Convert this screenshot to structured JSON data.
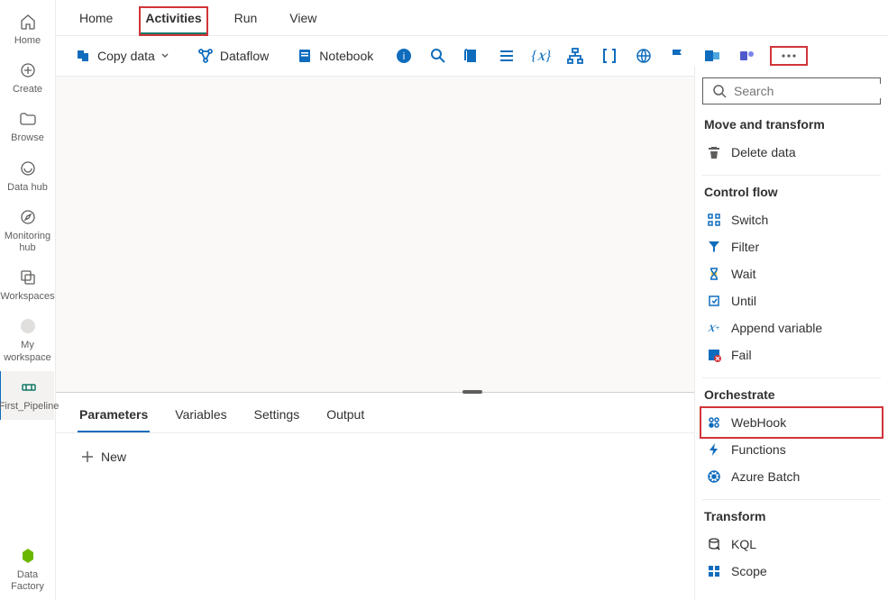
{
  "rail": {
    "items": [
      {
        "label": "Home",
        "icon": "home-icon"
      },
      {
        "label": "Create",
        "icon": "plus-circle-icon"
      },
      {
        "label": "Browse",
        "icon": "folder-icon"
      },
      {
        "label": "Data hub",
        "icon": "onelake-icon"
      },
      {
        "label": "Monitoring hub",
        "icon": "compass-icon"
      },
      {
        "label": "Workspaces",
        "icon": "workspaces-icon"
      },
      {
        "label": "My workspace",
        "icon": "avatar-icon"
      },
      {
        "label": "First_Pipeline",
        "icon": "pipeline-icon"
      }
    ],
    "footer": {
      "label": "Data Factory",
      "icon": "data-factory-icon"
    }
  },
  "tabs": {
    "items": [
      {
        "label": "Home"
      },
      {
        "label": "Activities",
        "active": true,
        "highlight": true
      },
      {
        "label": "Run"
      },
      {
        "label": "View"
      }
    ]
  },
  "toolbar": {
    "copy_data_label": "Copy data",
    "dataflow_label": "Dataflow",
    "notebook_label": "Notebook"
  },
  "bottom_tabs": {
    "items": [
      {
        "label": "Parameters",
        "active": true
      },
      {
        "label": "Variables"
      },
      {
        "label": "Settings"
      },
      {
        "label": "Output"
      }
    ],
    "new_label": "New"
  },
  "flyout": {
    "search_placeholder": "Search",
    "sections": [
      {
        "title": "Move and transform",
        "items": [
          {
            "label": "Delete data",
            "icon": "trash-icon"
          }
        ]
      },
      {
        "title": "Control flow",
        "items": [
          {
            "label": "Switch",
            "icon": "switch-icon"
          },
          {
            "label": "Filter",
            "icon": "filter-icon"
          },
          {
            "label": "Wait",
            "icon": "hourglass-icon"
          },
          {
            "label": "Until",
            "icon": "until-icon"
          },
          {
            "label": "Append variable",
            "icon": "variable-add-icon"
          },
          {
            "label": "Fail",
            "icon": "fail-icon"
          }
        ]
      },
      {
        "title": "Orchestrate",
        "items": [
          {
            "label": "WebHook",
            "icon": "webhook-icon",
            "highlight": true
          },
          {
            "label": "Functions",
            "icon": "functions-icon"
          },
          {
            "label": "Azure Batch",
            "icon": "batch-icon"
          }
        ]
      },
      {
        "title": "Transform",
        "items": [
          {
            "label": "KQL",
            "icon": "kql-icon"
          },
          {
            "label": "Scope",
            "icon": "scope-icon"
          }
        ]
      }
    ]
  }
}
